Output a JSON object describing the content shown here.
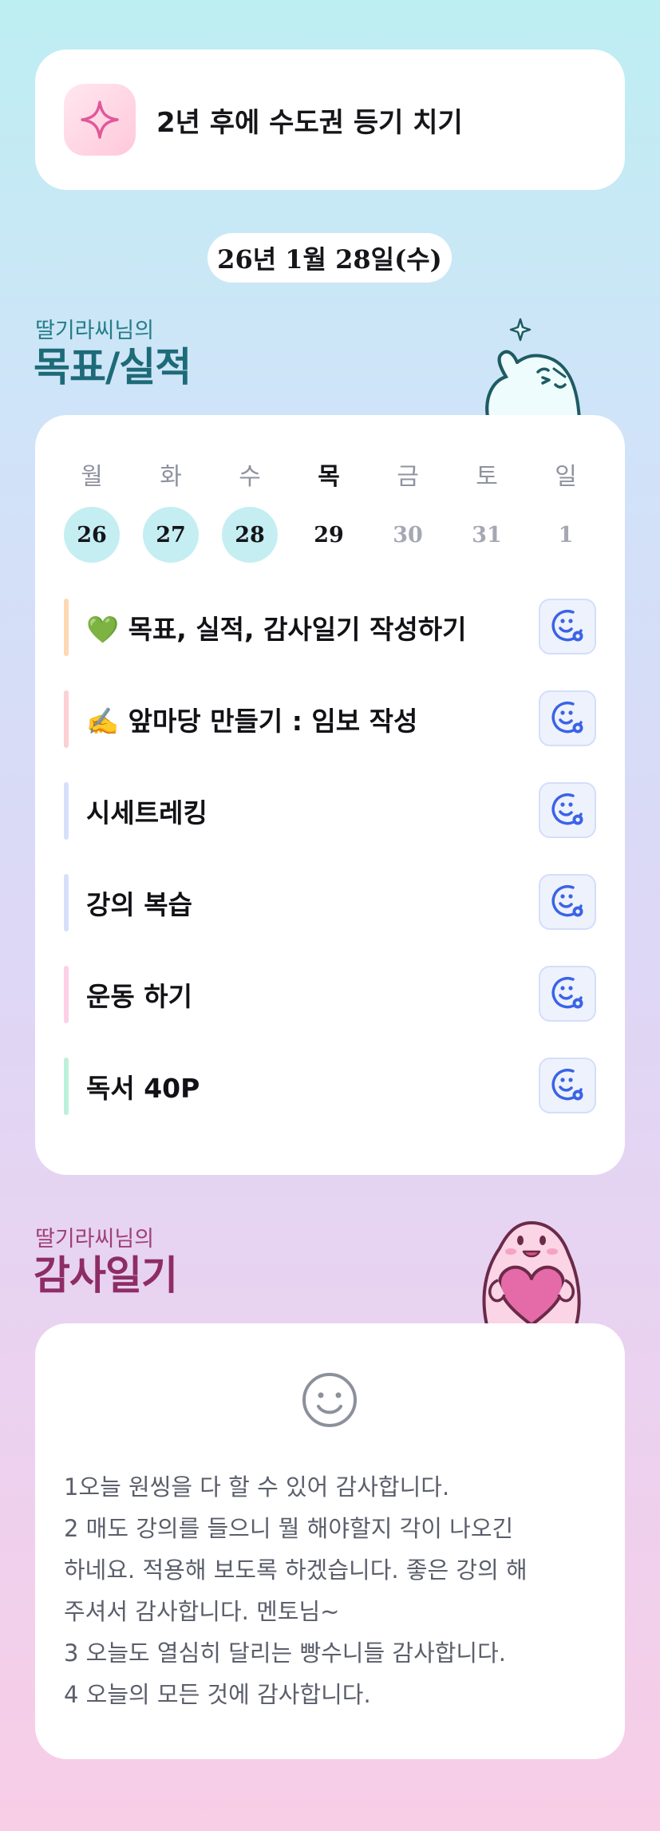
{
  "goal_banner": {
    "text": "2년 후에 수도권 등기 치기",
    "icon": "sparkle-icon"
  },
  "date": "26년 1월 28일(수)",
  "goals_section": {
    "subtitle": "딸기라씨님의",
    "title": "목표/실적"
  },
  "calendar": {
    "days": [
      {
        "label": "월",
        "date": "26",
        "state": "done"
      },
      {
        "label": "화",
        "date": "27",
        "state": "done"
      },
      {
        "label": "수",
        "date": "28",
        "state": "done"
      },
      {
        "label": "목",
        "date": "29",
        "state": "today"
      },
      {
        "label": "금",
        "date": "30",
        "state": "future"
      },
      {
        "label": "토",
        "date": "31",
        "state": "future"
      },
      {
        "label": "일",
        "date": "1",
        "state": "future"
      }
    ]
  },
  "todos": [
    {
      "text": "💚 목표, 실적, 감사일기 작성하기",
      "bar_color": "#fcd9b4"
    },
    {
      "text": "✍️ 앞마당 만들기 : 임보 작성",
      "bar_color": "#fcd0d4"
    },
    {
      "text": "시세트레킹",
      "bar_color": "#d6e0fa"
    },
    {
      "text": "강의 복습",
      "bar_color": "#d6e0fa"
    },
    {
      "text": "운동 하기",
      "bar_color": "#fcd0e6"
    },
    {
      "text": "독서 40P",
      "bar_color": "#bdf0dc"
    }
  ],
  "diary_section": {
    "subtitle": "딸기라씨님의",
    "title": "감사일기"
  },
  "diary": {
    "lines": [
      "1오늘 원씽을 다 할 수 있어 감사합니다.",
      "2 매도 강의를 들으니 뭘 해야할지 각이 나오긴",
      "하네요. 적용해 보도록 하겠습니다. 좋은 강의 해",
      "주셔서 감사합니다. 멘토님~",
      "3 오늘도 열심히 달리는 빵수니들 감사합니다.",
      "4 오늘의 모든 것에 감사합니다."
    ]
  },
  "colors": {
    "accent_teal": "#1d6a78",
    "accent_magenta": "#8e2c66",
    "done_circle": "#c4eef2",
    "check_button": "#3a63e6"
  }
}
